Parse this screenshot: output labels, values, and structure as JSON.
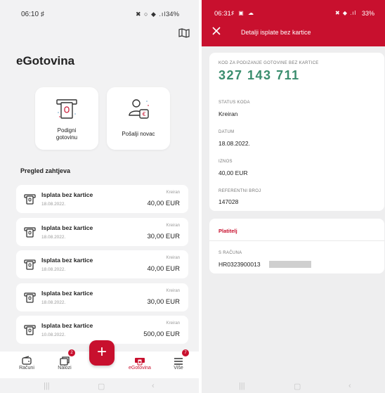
{
  "left": {
    "status_bar": {
      "time": "06:10",
      "time_icon": "♯",
      "icons": "✖ ○ ◆ .ıl",
      "battery": "34%"
    },
    "map_icon": "map-icon",
    "title": "eGotovina",
    "actions": [
      {
        "label_line1": "Podigni",
        "label_line2": "gotovinu",
        "icon": "atm-withdraw-icon"
      },
      {
        "label": "Pošalji novac",
        "icon": "send-money-icon"
      }
    ],
    "section_title": "Pregled zahtjeva",
    "requests": [
      {
        "title": "Isplata bez kartice",
        "date": "18.08.2022.",
        "status": "Kreiran",
        "amount": "40,00 EUR"
      },
      {
        "title": "Isplata bez kartice",
        "date": "18.08.2022.",
        "status": "Kreiran",
        "amount": "30,00 EUR"
      },
      {
        "title": "Isplata bez kartice",
        "date": "18.08.2022.",
        "status": "Kreiran",
        "amount": "40,00 EUR"
      },
      {
        "title": "Isplata bez kartice",
        "date": "18.08.2022.",
        "status": "Kreiran",
        "amount": "30,00 EUR"
      },
      {
        "title": "Isplata bez kartice",
        "date": "10.08.2022.",
        "status": "Kreiran",
        "amount": "500,00 EUR"
      }
    ],
    "tabs": [
      {
        "label": "Računi",
        "icon": "wallet-icon"
      },
      {
        "label": "Nalozi",
        "icon": "orders-icon",
        "badge": "2"
      },
      {
        "label": "eGotovina",
        "icon": "cash-icon"
      },
      {
        "label": "Više",
        "icon": "menu-icon",
        "badge": "7"
      }
    ],
    "fab_label": "+"
  },
  "right": {
    "status_bar": {
      "time": "06:31",
      "icons": "♯ ▣ ☁",
      "icons_right": "✖ ◆ .ıl",
      "battery": "33%"
    },
    "header_title": "Detalji isplate bez kartice",
    "details": {
      "code_label": "KOD ZA PODIZANJE GOTOVINE BEZ KARTICE",
      "code_value": "327 143 711",
      "status_label": "STATUS KODA",
      "status_value": "Kreiran",
      "date_label": "DATUM",
      "date_value": "18.08.2022.",
      "amount_label": "IZNOS",
      "amount_value": "40,00 EUR",
      "ref_label": "REFERENTNI BROJ",
      "ref_value": "147028"
    },
    "payer": {
      "title": "Platitelj",
      "account_label": "S RAČUNA",
      "account_value": "HR0323900013"
    }
  },
  "colors": {
    "brand_red": "#c8102e",
    "code_green": "#3a8d6e"
  }
}
